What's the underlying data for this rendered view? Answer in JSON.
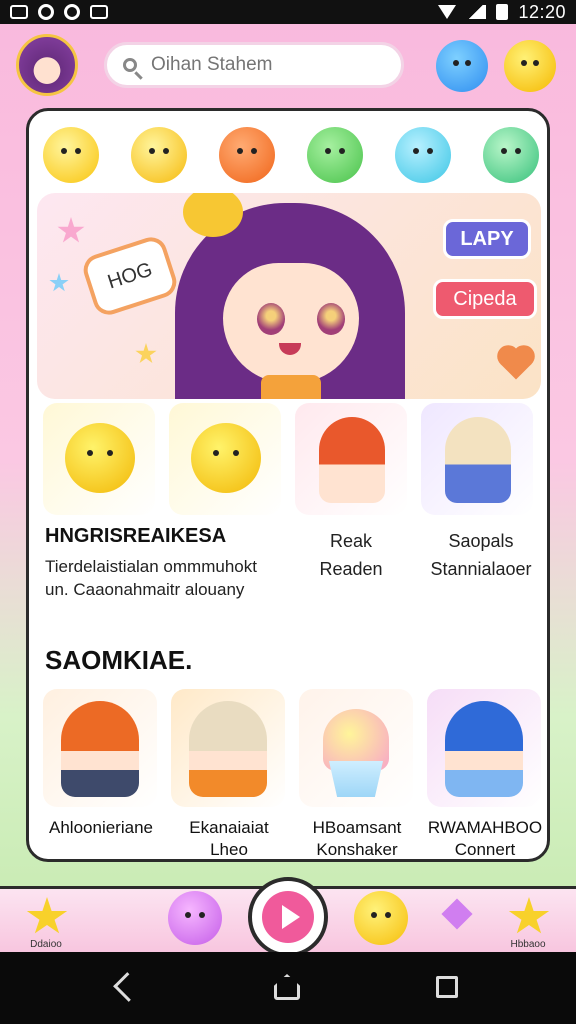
{
  "status_bar": {
    "time": "12:20"
  },
  "header": {
    "search": {
      "placeholder": "Oihan Stahem"
    }
  },
  "banner": {
    "sign_text": "HOG",
    "button_primary": "LAPY",
    "button_secondary": "Cipeda"
  },
  "section1": {
    "title": "HNGRISREAIKESA",
    "description": "Tierdelaistialan ommmuhokt un. Caaonahmaitr alouany",
    "items": [
      {
        "label": ""
      },
      {
        "label": ""
      },
      {
        "label": "Reak\nReaden"
      },
      {
        "label": "Saopals\nStannialaoer"
      }
    ]
  },
  "section2": {
    "title": "SAOMKIAE.",
    "items": [
      {
        "caption": "Ahloonieriane"
      },
      {
        "caption": "Ekanaiaiat\nLheo"
      },
      {
        "caption": "HBoamsant\nKonshaker"
      },
      {
        "caption": "RWAMAHBOO\nConnert"
      }
    ]
  },
  "bottom_nav": {
    "left_label": "Ddaioo",
    "right_label": "Hbbaoo"
  }
}
